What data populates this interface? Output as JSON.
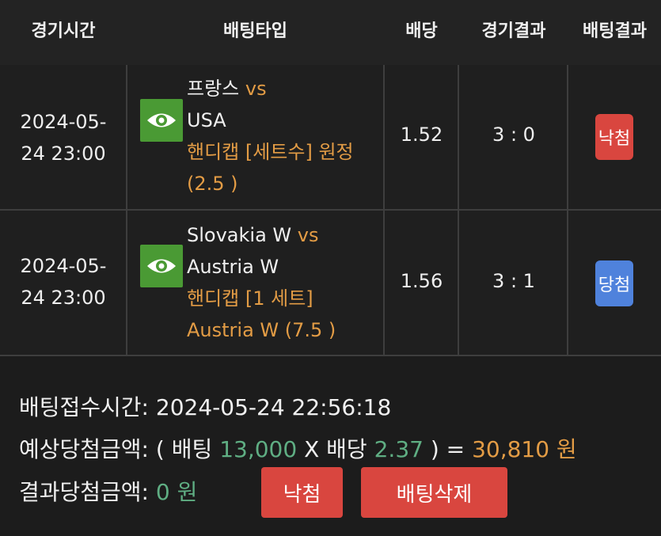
{
  "header": {
    "match_time": "경기시간",
    "bet_type": "배팅타입",
    "odds": "배당",
    "match_result": "경기결과",
    "bet_result": "배팅결과"
  },
  "rows": [
    {
      "time_line1": "2024-05-",
      "time_line2": "24 23:00",
      "home": "프랑스",
      "vs": "vs",
      "away": "USA",
      "market_line1": "핸디캡 [세트수] 원정",
      "market_line2": "(2.5 )",
      "odds": "1.52",
      "score": "3 : 0",
      "result": "낙첨",
      "result_color": "#d9463f"
    },
    {
      "time_line1": "2024-05-",
      "time_line2": "24 23:00",
      "home": "Slovakia W",
      "vs": "vs",
      "away": "Austria W",
      "market_line1": "핸디캡 [1 세트]",
      "market_line2": "Austria W (7.5 )",
      "odds": "1.56",
      "score": "3 : 1",
      "result": "당첨",
      "result_color": "#4f82dc"
    }
  ],
  "summary": {
    "received_label": "배팅접수시간:",
    "received_value": "2024-05-24 22:56:18",
    "expected_label": "예상당첨금액:",
    "open_paren": "(",
    "bet_label": "배팅",
    "bet_amount": "13,000",
    "times": "X",
    "odds_label": "배당",
    "total_odds": "2.37",
    "close_eq": ") =",
    "expected_amount": "30,810 원",
    "result_label": "결과당첨금액:",
    "result_amount": "0 원"
  },
  "buttons": {
    "lose_label": "낙첨",
    "delete_label": "배팅삭제"
  },
  "icons": {
    "row_icon": "eye-icon"
  },
  "colors": {
    "accent_orange": "#e39c45",
    "accent_green": "#5fae83",
    "lose_red": "#d9463f",
    "win_blue": "#4f82dc",
    "eye_green": "#4a9a34"
  }
}
